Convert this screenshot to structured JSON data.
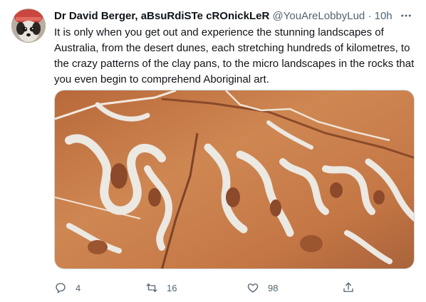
{
  "tweet": {
    "author_name": "Dr David Berger, aBsuRdiSTe cROnickLeR",
    "handle": "@YouAreLobbyLud",
    "separator": "·",
    "time": "10h",
    "text": "It is only when you get out and experience the stunning landscapes of Australia, from the desert dunes, each stretching hundreds of kilometres, to the crazy patterns of the clay pans, to the micro landscapes in the rocks that you even begin to comprehend Aboriginal art.",
    "more_icon": "more-horizontal-icon"
  },
  "actions": {
    "reply": {
      "icon": "reply-icon",
      "count": "4"
    },
    "retweet": {
      "icon": "retweet-icon",
      "count": "16"
    },
    "like": {
      "icon": "heart-icon",
      "count": "98"
    },
    "share": {
      "icon": "share-icon"
    }
  },
  "colors": {
    "text_primary": "#0f1419",
    "text_secondary": "#536471",
    "rock_orange": "#c97a45",
    "rock_white": "#e9e6e1"
  }
}
